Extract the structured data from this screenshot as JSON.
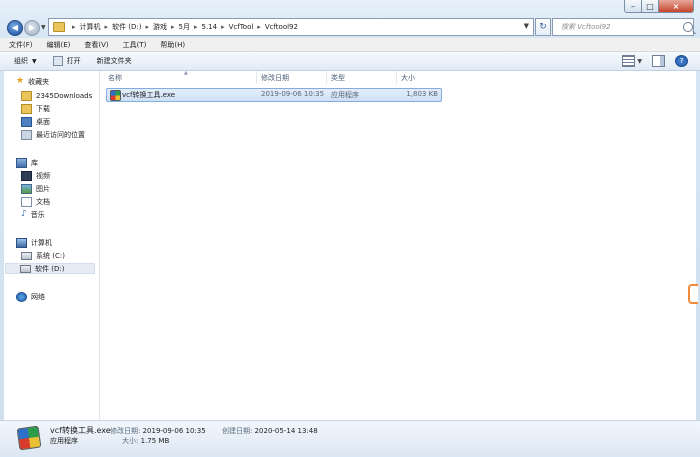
{
  "window": {
    "breadcrumbs": [
      "计算机",
      "软件 (D:)",
      "游戏",
      "5月",
      "5.14",
      "VcfTool",
      "Vcftool92"
    ],
    "search_placeholder": "搜索 Vcftool92",
    "controls": {
      "minimize": "–",
      "maximize": "□",
      "close": "×"
    }
  },
  "menu": [
    "文件(F)",
    "编辑(E)",
    "查看(V)",
    "工具(T)",
    "帮助(H)"
  ],
  "toolbar": {
    "organize": "组织",
    "open": "打开",
    "new_folder": "新建文件夹",
    "help": "?"
  },
  "sidebar": {
    "favorites": {
      "label": "收藏夹",
      "items": [
        "2345Downloads",
        "下载",
        "桌面",
        "最近访问的位置"
      ]
    },
    "libraries": {
      "label": "库",
      "items": [
        "视频",
        "图片",
        "文档",
        "音乐"
      ]
    },
    "computer": {
      "label": "计算机",
      "items": [
        "系统 (C:)",
        "软件 (D:)"
      ],
      "selected": "软件 (D:)"
    },
    "network": {
      "label": "网络"
    }
  },
  "file_list": {
    "columns": [
      "名称",
      "修改日期",
      "类型",
      "大小"
    ],
    "rows": [
      {
        "name": "vcf转换工具.exe",
        "modified": "2019-09-06 10:35",
        "type": "应用程序",
        "size": "1,803 KB",
        "selected": true
      }
    ]
  },
  "details": {
    "name": "vcf转换工具.exe",
    "type": "应用程序",
    "modified_label": "修改日期:",
    "modified": "2019-09-06 10:35",
    "created_label": "创建日期:",
    "created": "2020-05-14 13:48",
    "size_label": "大小:",
    "size": "1.75 MB"
  },
  "icons": {
    "back": "back-arrow-icon",
    "forward": "forward-arrow-icon",
    "refresh": "refresh-icon",
    "search": "search-icon",
    "file": "exe-app-icon"
  }
}
